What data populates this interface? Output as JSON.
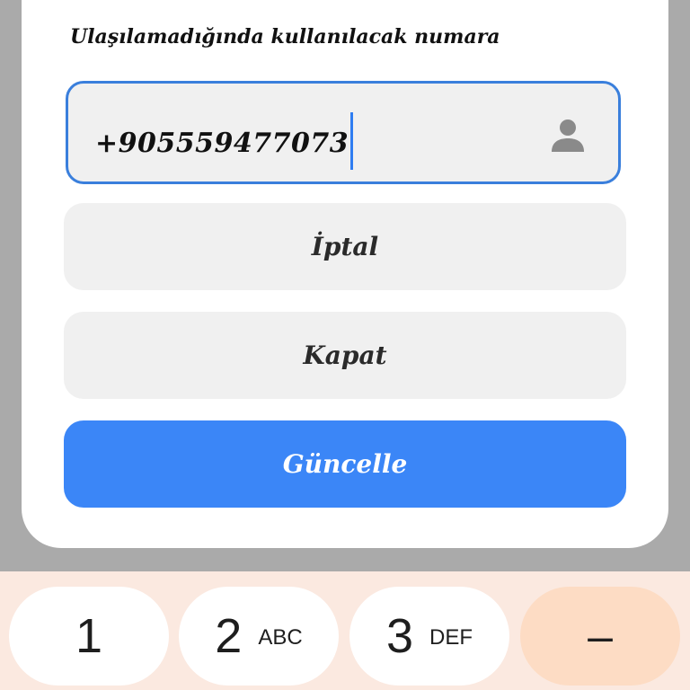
{
  "form": {
    "label": "Ulaşılamadığında kullanılacak numara",
    "phone_value": "+905559477073",
    "field_icon": "person-icon"
  },
  "buttons": {
    "cancel_label": "İptal",
    "close_label": "Kapat",
    "update_label": "Güncelle"
  },
  "keyboard": {
    "keys": [
      {
        "digit": "1",
        "letters": ""
      },
      {
        "digit": "2",
        "letters": "ABC"
      },
      {
        "digit": "3",
        "letters": "DEF"
      },
      {
        "digit": "–",
        "letters": ""
      }
    ]
  },
  "colors": {
    "accent": "#3b86f7",
    "field_border": "#3a7fdc",
    "keyboard_bg": "#fbe9e0",
    "special_key": "#fddcc4"
  }
}
